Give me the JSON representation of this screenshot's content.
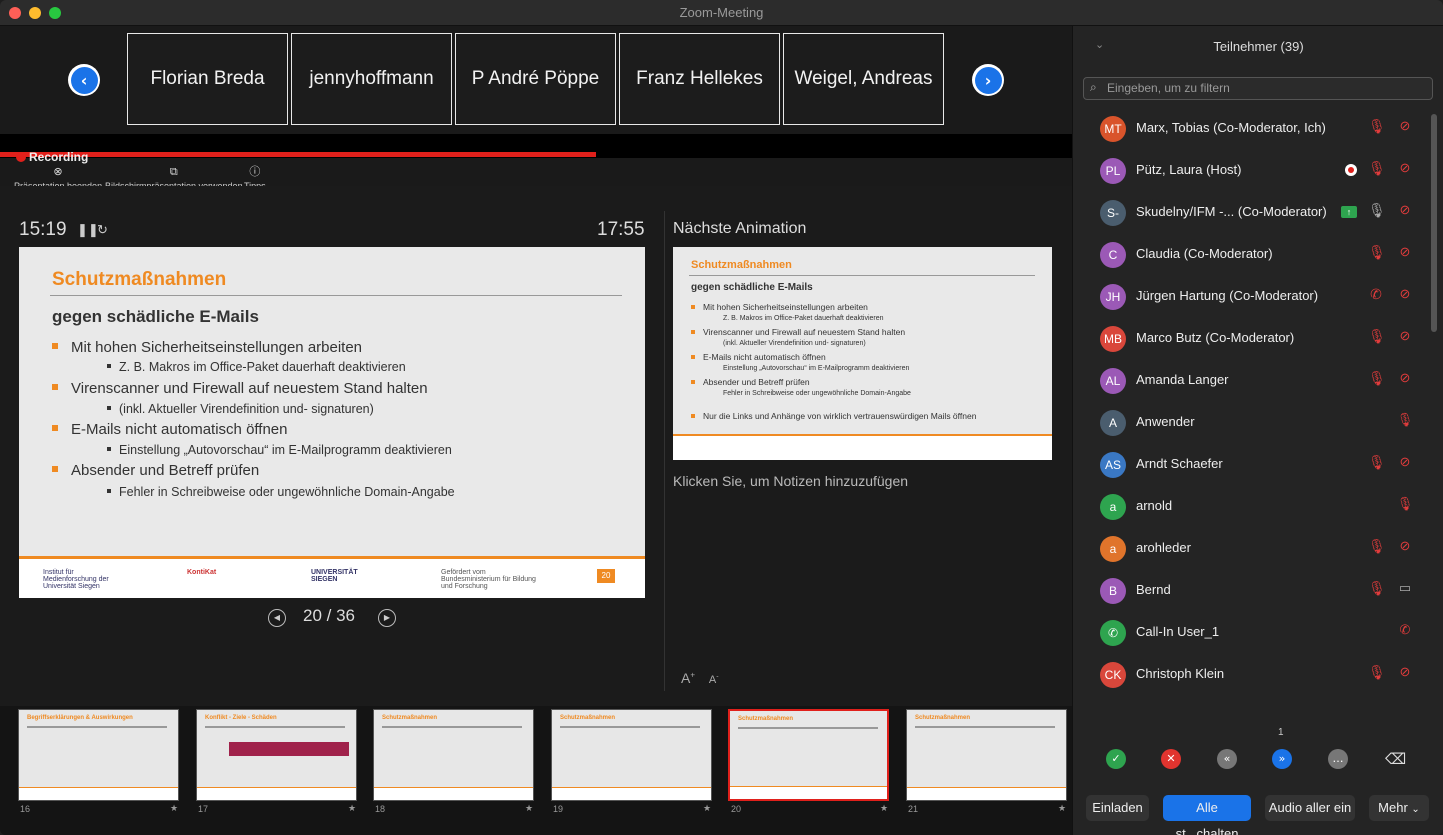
{
  "window": {
    "title": "Zoom-Meeting"
  },
  "gallery": {
    "tiles": [
      "Florian Breda",
      "jennyhoffmann",
      "P André Pöppe",
      "Franz Hellekes",
      "Weigel, Andreas"
    ]
  },
  "recording": {
    "label": "Recording"
  },
  "toolbar": {
    "end_label": "Präsentation beenden",
    "screen_label": "Bildschirmpräsentation verwenden",
    "tips_label": "Tipps"
  },
  "presenter": {
    "elapsed": "15:19",
    "clock": "17:55",
    "page": "20 / 36",
    "next_title": "Nächste Animation",
    "notes_placeholder": "Klicken Sie, um Notizen hinzuzufügen"
  },
  "slide": {
    "title": "Schutzmaßnahmen",
    "subtitle": "gegen schädliche E-Mails",
    "b1": "Mit hohen Sicherheitseinstellungen arbeiten",
    "b1_sub": "Z. B. Makros im Office-Paket dauerhaft deaktivieren",
    "b2": "Virenscanner und Firewall auf neuestem Stand halten",
    "b2_sub": "(inkl. Aktueller Virendefinition und- signaturen)",
    "b3": "E-Mails nicht automatisch öffnen",
    "b3_sub": "Einstellung „Autovorschau“ im E-Mailprogramm deaktivieren",
    "b4": "Absender und Betreff prüfen",
    "b4_sub": "Fehler in Schreibweise oder ungewöhnliche Domain-Angabe",
    "b5": "Nur die Links und Anhänge von wirklich vertrauenswürdigen Mails öffnen",
    "page_no": "20",
    "footer_logos": [
      "Institut für Medienforschung der Universität Siegen",
      "KontiKat",
      "UNIVERSITÄT SIEGEN",
      "Gefördert vom Bundesministerium für Bildung und Forschung"
    ]
  },
  "thumbnails": [
    {
      "num": "16",
      "title": "Begriffserklärungen & Auswirkungen"
    },
    {
      "num": "17",
      "title": "Konflikt - Ziele - Schäden"
    },
    {
      "num": "18",
      "title": "Schutzmaßnahmen"
    },
    {
      "num": "19",
      "title": "Schutzmaßnahmen"
    },
    {
      "num": "20",
      "title": "Schutzmaßnahmen",
      "selected": true
    },
    {
      "num": "21",
      "title": "Schutzmaßnahmen"
    }
  ],
  "participants": {
    "title": "Teilnehmer (39)",
    "filter_placeholder": "Eingeben, um zu filtern",
    "list": [
      {
        "initials": "MT",
        "name": "Marx, Tobias (Co-Moderator, Ich)",
        "color": "#d9542b"
      },
      {
        "initials": "PL",
        "name": "Pütz, Laura (Host)",
        "color": "#9b59b6"
      },
      {
        "initials": "S-",
        "name": "Skudelny/IFM -... (Co-Moderator)",
        "color": "#4a5d6e"
      },
      {
        "initials": "C",
        "name": "Claudia (Co-Moderator)",
        "color": "#9b59b6"
      },
      {
        "initials": "JH",
        "name": "Jürgen Hartung (Co-Moderator)",
        "color": "#9b59b6"
      },
      {
        "initials": "MB",
        "name": "Marco Butz (Co-Moderator)",
        "color": "#d9473b"
      },
      {
        "initials": "AL",
        "name": "Amanda Langer",
        "color": "#9b59b6"
      },
      {
        "initials": "A",
        "name": "Anwender",
        "color": "#4a5d6e"
      },
      {
        "initials": "AS",
        "name": "Arndt Schaefer",
        "color": "#3a78c4"
      },
      {
        "initials": "a",
        "name": "arnold",
        "color": "#2ea44f"
      },
      {
        "initials": "a",
        "name": "arohleder",
        "color": "#e0742b"
      },
      {
        "initials": "B",
        "name": "Bernd",
        "color": "#9b59b6"
      },
      {
        "initials": "✆",
        "name": "Call-In User_1",
        "color": "#2ea44f"
      },
      {
        "initials": "CK",
        "name": "Christoph Klein",
        "color": "#d9473b"
      }
    ],
    "reaction_count": "1",
    "invite_label": "Einladen",
    "mute_all_label": "Alle st...chalten",
    "audio_label": "Audio aller ein",
    "more_label": "Mehr"
  },
  "colors": {
    "accent": "#ef8a22",
    "recording": "#e0201b",
    "zoom_blue": "#1a73e8",
    "muted": "#e03c3c"
  }
}
